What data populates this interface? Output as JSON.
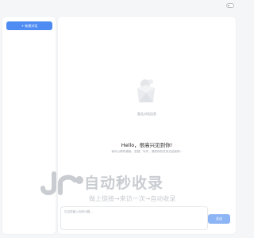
{
  "topbar": {
    "theme_toggle_icon": "toggle-icon"
  },
  "sidebar": {
    "new_chat_label": "+  新建对话"
  },
  "main": {
    "empty_state": {
      "icon": "empty-box-icon",
      "text": "暂无对话信息"
    },
    "greeting": "Hello，很高兴见到你!",
    "subtitle": "我可以帮你搜索、答疑、写作，请把你的任务交给我吧~"
  },
  "watermark": {
    "logo_icon": "jr-logo-icon",
    "main_text": "自动秒收录",
    "sub_text": "做上链接→来访一次→自动收录"
  },
  "composer": {
    "placeholder": "在这里输入你的问题...",
    "send_label": "发送"
  }
}
